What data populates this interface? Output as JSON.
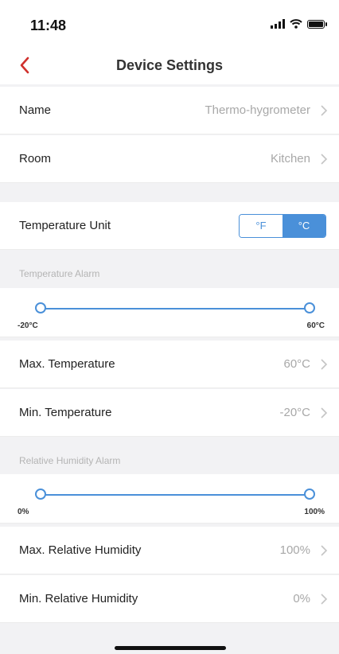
{
  "status_bar": {
    "time": "11:48"
  },
  "nav": {
    "title": "Device Settings"
  },
  "device": {
    "name_label": "Name",
    "name_value": "Thermo-hygrometer",
    "room_label": "Room",
    "room_value": "Kitchen"
  },
  "temperature_unit": {
    "label": "Temperature Unit",
    "option_f": "°F",
    "option_c": "°C",
    "selected": "°C"
  },
  "temperature_alarm": {
    "section_label": "Temperature Alarm",
    "range_min": "-20°C",
    "range_max": "60°C",
    "max_label": "Max. Temperature",
    "max_value": "60°C",
    "min_label": "Min. Temperature",
    "min_value": "-20°C"
  },
  "humidity_alarm": {
    "section_label": "Relative Humidity Alarm",
    "range_min": "0%",
    "range_max": "100%",
    "max_label": "Max. Relative Humidity",
    "max_value": "100%",
    "min_label": "Min. Relative Humidity",
    "min_value": "0%"
  },
  "colors": {
    "accent": "#4a90d9",
    "back_arrow": "#d0312d",
    "secondary_text": "#a8a8a8",
    "background": "#f2f2f4"
  },
  "icons": [
    "back-arrow-icon",
    "chevron-right-icon",
    "signal-icon",
    "wifi-icon",
    "battery-icon"
  ]
}
